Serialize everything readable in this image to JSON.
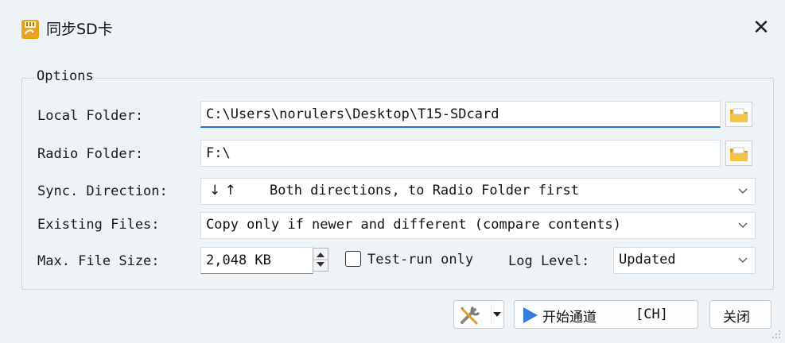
{
  "window": {
    "title": "同步SD卡",
    "close_glyph": "✕",
    "icon": "sd-card-sync-icon"
  },
  "options": {
    "group_label": "Options",
    "local_folder_label": "Local Folder:",
    "local_folder_value": "C:\\Users\\norulers\\Desktop\\T15-SDcard",
    "radio_folder_label": "Radio Folder:",
    "radio_folder_value": "F:\\",
    "sync_direction_label": "Sync. Direction:",
    "sync_direction_arrows": "↓ ↑",
    "sync_direction_value": "Both directions, to Radio Folder first",
    "existing_files_label": "Existing Files:",
    "existing_files_value": "Copy only if newer and different (compare contents)",
    "max_file_size_label": "Max. File Size:",
    "max_file_size_value": "2,048 KB",
    "test_run_label": "Test-run only",
    "test_run_checked": false,
    "log_level_label": "Log Level:",
    "log_level_value": "Updated"
  },
  "buttons": {
    "tools_icon": "tools-icon",
    "start_label": "开始通道",
    "start_shortcut": "[CH]",
    "close_label": "关闭"
  },
  "colors": {
    "accent": "#1f6fd1",
    "folder": "#f0b52a",
    "play": "#2f7fe0"
  }
}
